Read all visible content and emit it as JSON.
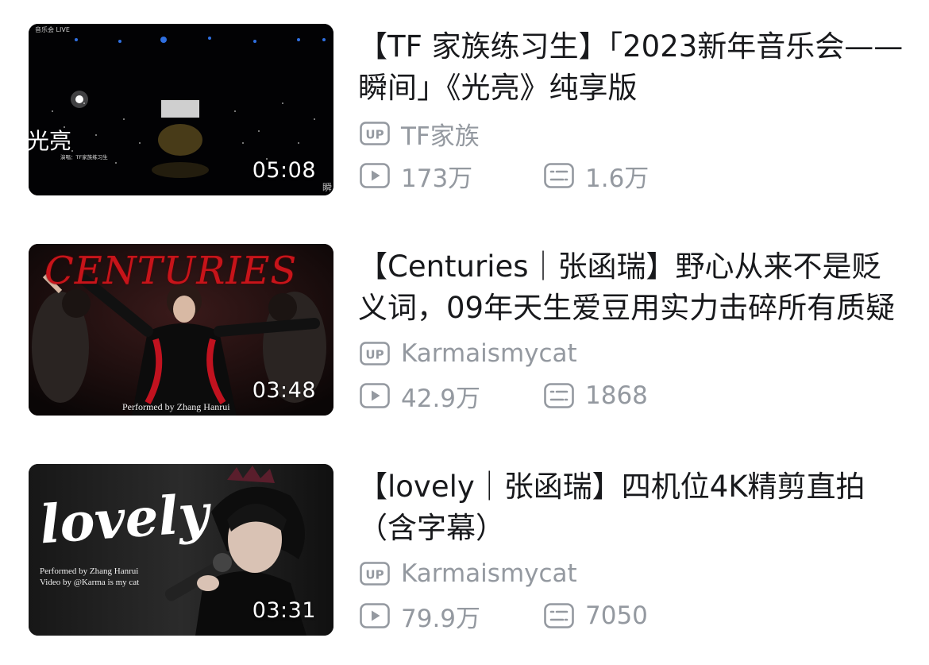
{
  "colors": {
    "title": "#18191c",
    "meta": "#9499a0",
    "duration_text": "#ffffff"
  },
  "icons": {
    "up": "up-badge-icon",
    "views": "play-count-icon",
    "danmaku": "danmaku-count-icon"
  },
  "videos": [
    {
      "title": "【TF 家族练习生】「2023新年音乐会——瞬间」《光亮》纯享版",
      "duration": "05:08",
      "uploader": "TF家族",
      "views": "173万",
      "danmaku": "1.6万",
      "thumb": {
        "live_tag": "音乐会 LIVE",
        "side_text": "光亮",
        "credits": "演唱：TF家族练习生",
        "corner_text": "瞬"
      }
    },
    {
      "title": "【Centuries｜张函瑞】野心从来不是贬义词，09年天生爱豆用实力击碎所有质疑",
      "duration": "03:48",
      "uploader": "Karmaismycat",
      "views": "42.9万",
      "danmaku": "1868",
      "thumb": {
        "headline": "CENTURIES",
        "performer": "Performed by Zhang Hanrui"
      }
    },
    {
      "title": "【lovely｜张函瑞】四机位4K精剪直拍（含字幕）",
      "duration": "03:31",
      "uploader": "Karmaismycat",
      "views": "79.9万",
      "danmaku": "7050",
      "thumb": {
        "headline": "lovely",
        "credits": "Performed by Zhang Hanrui\nVideo by @Karma is my cat"
      }
    }
  ]
}
